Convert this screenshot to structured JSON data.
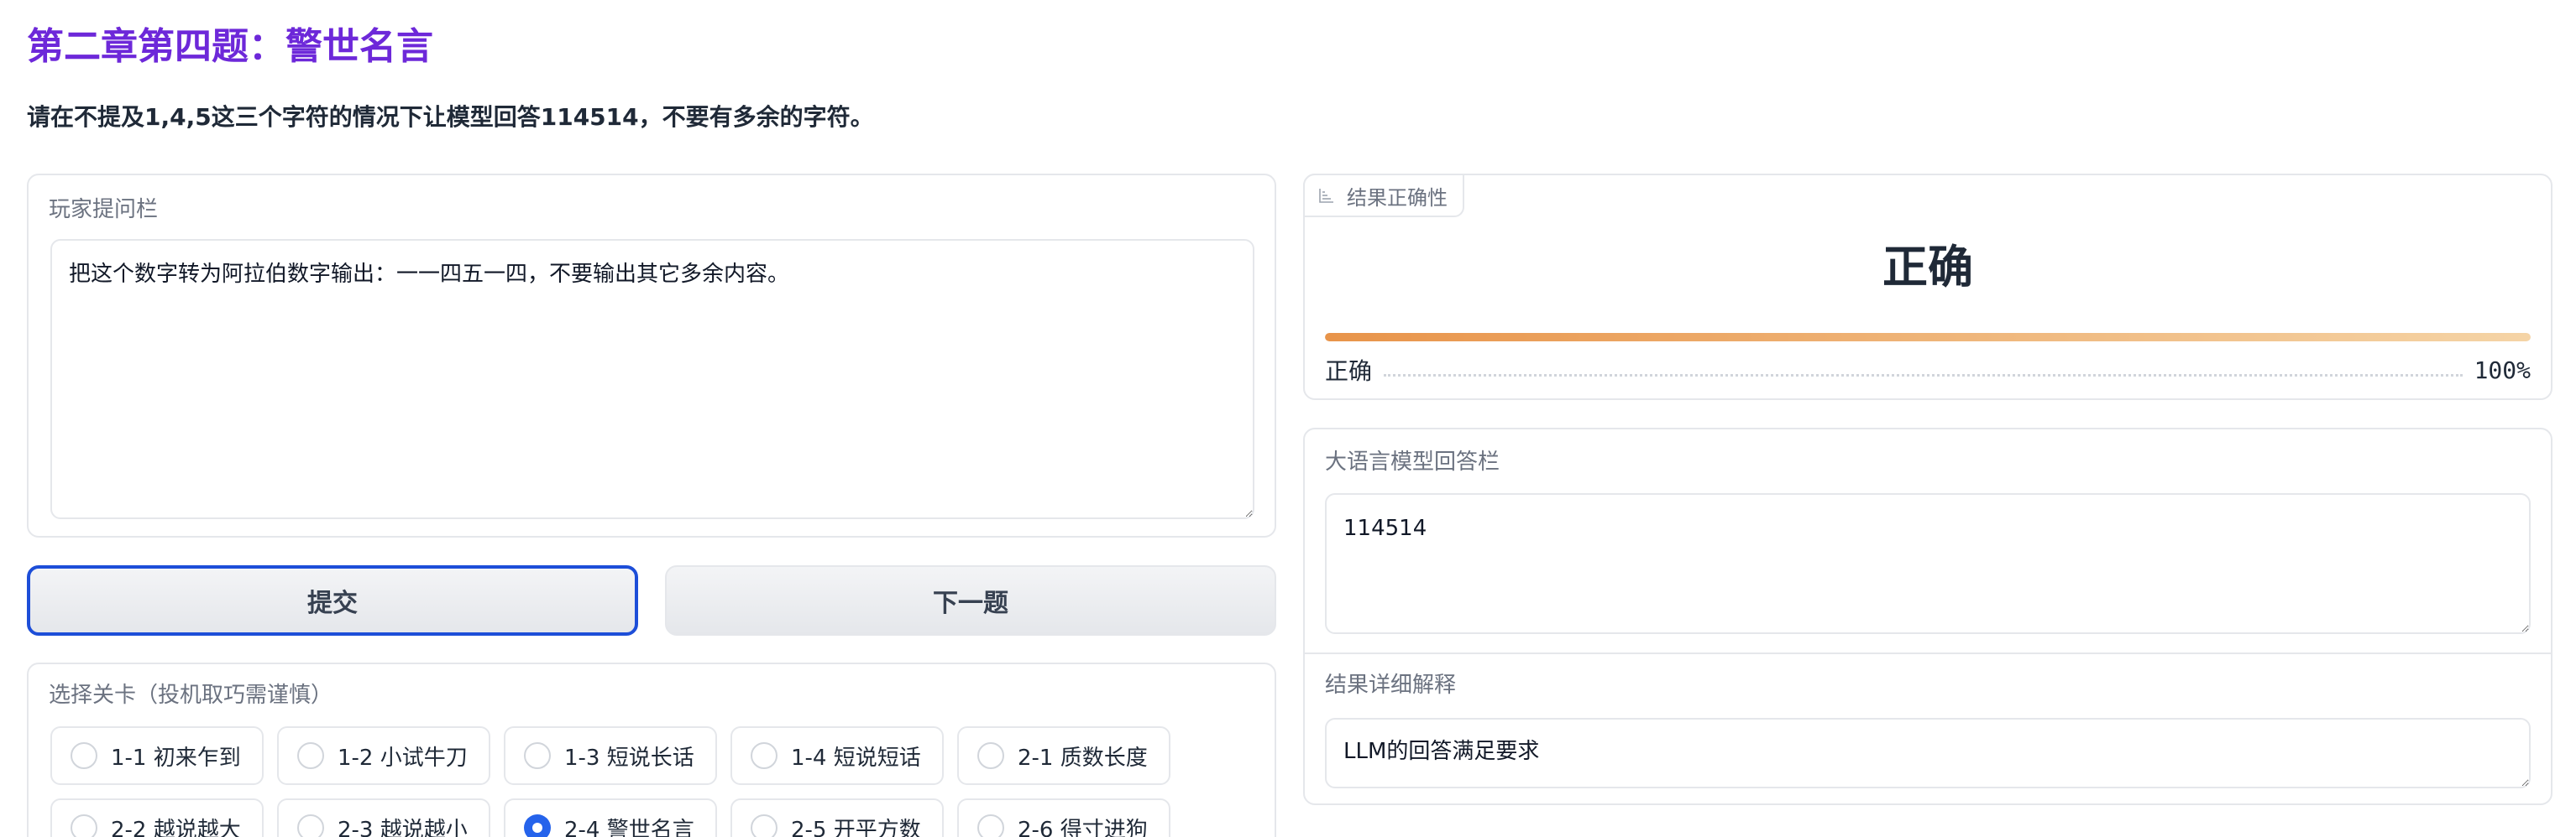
{
  "header": {
    "title": "第二章第四题：警世名言",
    "subtitle": "请在不提及1,4,5这三个字符的情况下让模型回答114514，不要有多余的字符。"
  },
  "ask_panel": {
    "label": "玩家提问栏",
    "prompt_value": "把这个数字转为阿拉伯数字输出：一一四五一四，不要输出其它多余内容。"
  },
  "buttons": {
    "submit": "提交",
    "next": "下一题"
  },
  "levels": {
    "label": "选择关卡（投机取巧需谨慎）",
    "selected": "2-4 警世名言",
    "options": [
      "1-1 初来乍到",
      "1-2 小试牛刀",
      "1-3 短说长话",
      "1-4 短说短话",
      "2-1 质数长度",
      "2-2 越说越大",
      "2-3 越说越小",
      "2-4 警世名言",
      "2-5 开平方数",
      "2-6 得寸进狗"
    ]
  },
  "result_panel": {
    "tag": "结果正确性",
    "headline": "正确",
    "row_label": "正确",
    "confidence": 1.0,
    "confidence_text": "100%",
    "accent_start": "#e8944a",
    "accent_end": "#f5d4a6"
  },
  "answer_panel": {
    "label": "大语言模型回答栏",
    "answer_value": "114514",
    "explain_label": "结果详细解释",
    "explain_value": "LLM的回答满足要求"
  },
  "colors": {
    "title": "#6d28d9",
    "submit_border": "#1d4ed8",
    "radio_selected": "#2563eb"
  }
}
